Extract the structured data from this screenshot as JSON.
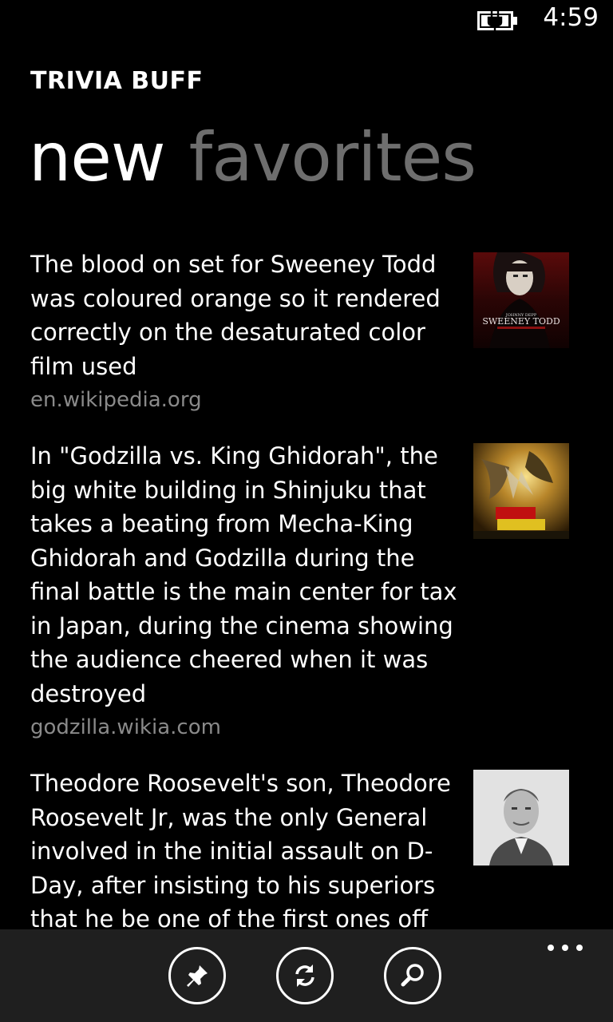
{
  "status": {
    "time": "4:59",
    "battery_icon": "battery-charging-icon"
  },
  "app": {
    "title": "TRIVIA BUFF"
  },
  "pivot": {
    "tabs": [
      {
        "label": "new",
        "active": true
      },
      {
        "label": "favorites",
        "active": false
      }
    ]
  },
  "items": [
    {
      "text": "The blood on set for Sweeney Todd was coloured orange so it rendered correctly on the desaturated color film used",
      "source": "en.wikipedia.org",
      "thumbnail": "sweeney-todd-poster-image",
      "thumbnail_text": [
        "JOHNNY DEPP",
        "SWEENEY TODD"
      ]
    },
    {
      "text": "In \"Godzilla vs. King Ghidorah\", the big white building in Shinjuku that takes a beating from Mecha-King Ghidorah and Godzilla during the final battle is the main center for tax in Japan, during the cinema showing the audience cheered when it was destroyed",
      "source": "godzilla.wikia.com",
      "thumbnail": "godzilla-poster-image"
    },
    {
      "text": "Theodore Roosevelt's son, Theodore Roosevelt Jr, was the only General involved in the initial assault on D-Day, after insisting to his superiors that he be one of the first ones off the",
      "source": "",
      "thumbnail": "portrait-photo-image"
    }
  ],
  "app_bar": {
    "buttons": [
      {
        "name": "pin-button",
        "icon": "pin-icon"
      },
      {
        "name": "refresh-button",
        "icon": "refresh-icon"
      },
      {
        "name": "search-button",
        "icon": "search-icon"
      }
    ],
    "more_icon": "more-icon"
  },
  "colors": {
    "background": "#000000",
    "inactive_tab": "#6e6e6e",
    "source_text": "#8a8a8a",
    "app_bar": "#1f1f1f"
  }
}
